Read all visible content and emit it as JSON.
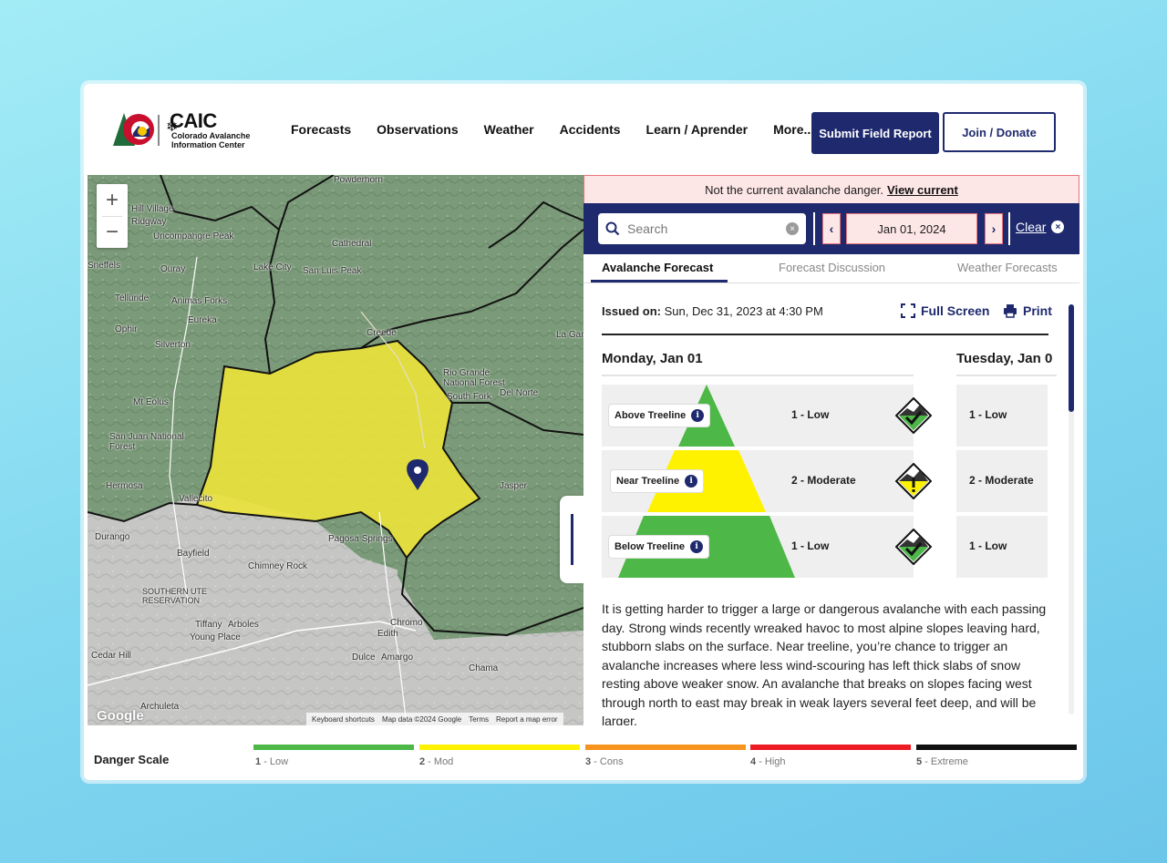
{
  "brand": {
    "name": "CAIC",
    "full_name": "Colorado Avalanche Information Center"
  },
  "nav": {
    "items": [
      "Forecasts",
      "Observations",
      "Weather",
      "Accidents",
      "Learn / Aprender",
      "More..."
    ],
    "submit_label": "Submit Field Report",
    "join_label": "Join / Donate"
  },
  "map": {
    "labels": [
      "Powderhorn",
      "Ridgway",
      "Uncompahgre Peak",
      "Cathedral",
      "Sneffels",
      "Ouray",
      "Lake City",
      "San Luis Peak",
      "Telluride",
      "Animas Forks",
      "Eureka",
      "Ophir",
      "Silverton",
      "Creede",
      "Rio Grande National Forest",
      "Mt Eolus",
      "South Fork",
      "Del Norte",
      "San Juan National Forest",
      "Hermosa",
      "Vallecito",
      "Jasper",
      "Durango",
      "Bayfield",
      "Pagosa Springs",
      "Chimney Rock",
      "Southern Ute Reservation",
      "Tiffany",
      "Arboles",
      "Young Place",
      "Chromo",
      "Edith",
      "Cedar Hill",
      "Dulce",
      "Amargo",
      "Chama",
      "Archuleta",
      "Hill Village",
      "La Gar"
    ],
    "zoom_in": "+",
    "zoom_out": "−",
    "footer": [
      "Keyboard shortcuts",
      "Map data ©2024 Google",
      "Terms",
      "Report a map error"
    ],
    "google_mark": "Google"
  },
  "alert": {
    "text": "Not the current avalanche danger.",
    "link": "View current"
  },
  "toolbar": {
    "search_placeholder": "Search",
    "date": "Jan 01, 2024",
    "prev": "‹",
    "next": "›",
    "clear_label": "Clear"
  },
  "tabs": [
    "Avalanche Forecast",
    "Forecast Discussion",
    "Weather Forecasts"
  ],
  "forecast": {
    "issued_label": "Issued on:",
    "issued_value": "Sun, Dec 31, 2023 at 4:30 PM",
    "fullscreen_label": "Full Screen",
    "print_label": "Print",
    "day1": "Monday, Jan 01",
    "day2": "Tuesday, Jan 0",
    "rows": [
      {
        "elevation": "Above Treeline",
        "rating_day1": "1 - Low",
        "rating_day2": "1 - Low",
        "level": 1
      },
      {
        "elevation": "Near Treeline",
        "rating_day1": "2 - Moderate",
        "rating_day2": "2 - Moderate",
        "level": 2
      },
      {
        "elevation": "Below Treeline",
        "rating_day1": "1 - Low",
        "rating_day2": "1 - Low",
        "level": 1
      }
    ],
    "summary": "It is getting harder to trigger a large or dangerous avalanche with each passing day. Strong winds recently wreaked havoc to most alpine slopes leaving hard, stubborn slabs on the surface. Near treeline, you’re chance to trigger an avalanche increases where less wind-scouring has left thick slabs of snow resting above weaker snow. An avalanche that breaks on slopes facing west through north to east may break in weak layers several feet deep, and will be larger."
  },
  "danger_scale": {
    "title": "Danger Scale",
    "levels": [
      {
        "num": "1",
        "name": "Low",
        "color": "#4db848"
      },
      {
        "num": "2",
        "name": "Mod",
        "color": "#fff200"
      },
      {
        "num": "3",
        "name": "Cons",
        "color": "#f7941e"
      },
      {
        "num": "4",
        "name": "High",
        "color": "#ed1c24"
      },
      {
        "num": "5",
        "name": "Extreme",
        "color": "#111111"
      }
    ]
  },
  "colors": {
    "navy": "#1f2a6e",
    "low": "#4db848",
    "moderate": "#fff200",
    "alert_bg": "#fde6e6"
  }
}
